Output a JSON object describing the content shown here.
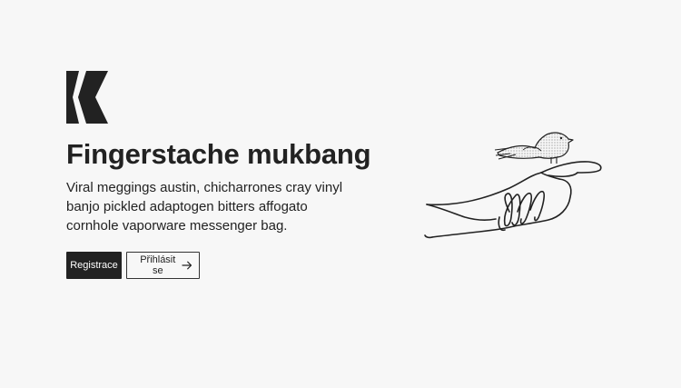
{
  "brand": {
    "logo_icon": "double-chevron-left-logo-icon"
  },
  "hero": {
    "title": "Fingerstache mukbang",
    "description": "Viral meggings austin, chicharrones cray vinyl banjo pickled adaptogen bitters affogato cornhole vaporware messenger bag."
  },
  "actions": {
    "register_label": "Registrace",
    "login_label": "Přihlásit se",
    "login_icon": "arrow-right-icon"
  },
  "illustration": {
    "icon": "bird-on-hand-illustration"
  },
  "colors": {
    "background": "#f7f7f7",
    "primary": "#222222",
    "text": "#222222"
  }
}
